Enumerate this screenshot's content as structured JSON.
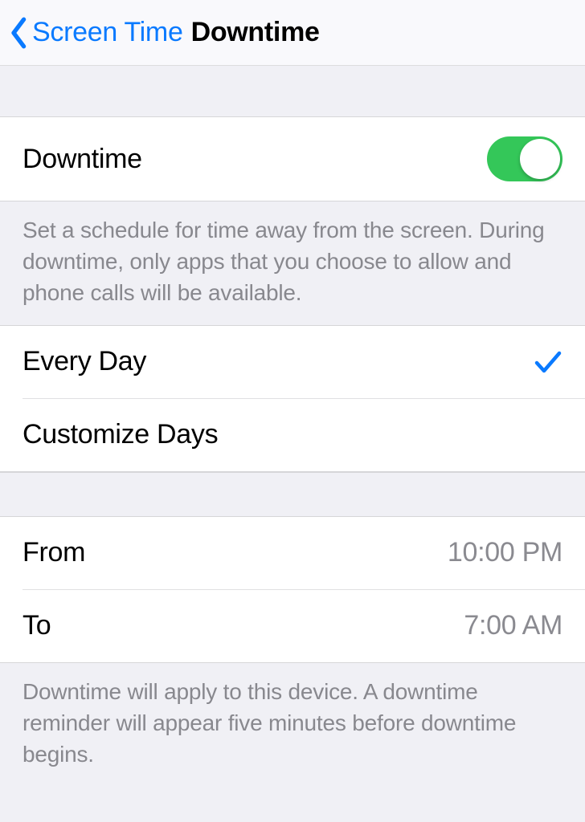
{
  "nav": {
    "back_label": "Screen Time",
    "title": "Downtime"
  },
  "toggle_row": {
    "label": "Downtime",
    "enabled": true
  },
  "footer1": "Set a schedule for time away from the screen. During downtime, only apps that you choose to allow and phone calls will be available.",
  "schedule_options": {
    "every_day": "Every Day",
    "customize": "Customize Days",
    "selected": "every_day"
  },
  "time_range": {
    "from_label": "From",
    "from_value": "10:00 PM",
    "to_label": "To",
    "to_value": "7:00 AM"
  },
  "footer2": "Downtime will apply to this device. A downtime reminder will appear five minutes before downtime begins."
}
